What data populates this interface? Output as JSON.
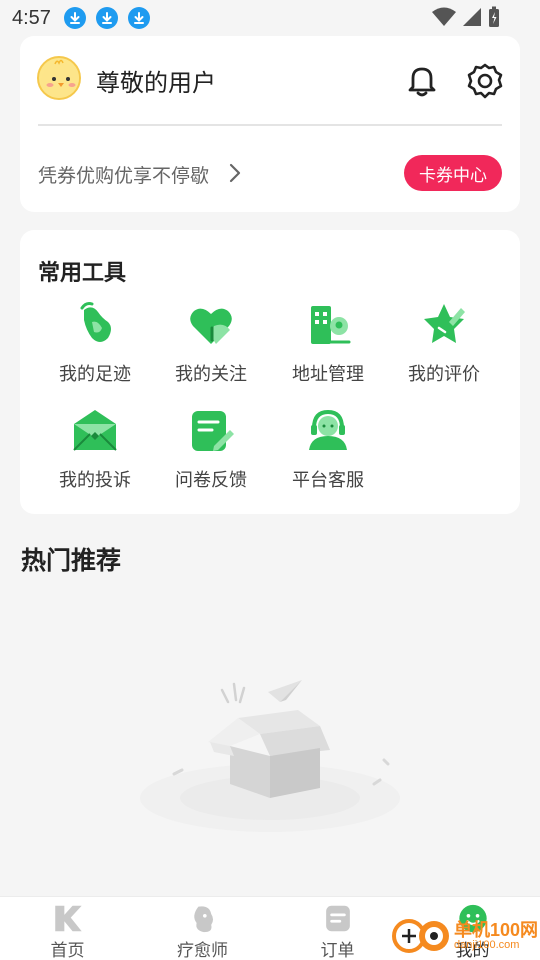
{
  "status_bar": {
    "time": "4:57",
    "download_icons": [
      "download-icon",
      "download-icon",
      "download-icon"
    ],
    "right_icons": [
      "wifi-icon",
      "signal-icon",
      "battery-icon"
    ]
  },
  "user_card": {
    "avatar_icon": "chick-avatar",
    "username": "尊敬的用户",
    "bell_icon": "bell-icon",
    "settings_icon": "gear-icon",
    "voucher_text": "凭券优购优享不停歇",
    "coupon_center_label": "卡券中心"
  },
  "tools": {
    "title": "常用工具",
    "items": [
      {
        "label": "我的足迹",
        "icon": "footprint-icon"
      },
      {
        "label": "我的关注",
        "icon": "heart-icon"
      },
      {
        "label": "地址管理",
        "icon": "location-building-icon"
      },
      {
        "label": "我的评价",
        "icon": "star-pen-icon"
      },
      {
        "label": "我的投诉",
        "icon": "envelope-icon"
      },
      {
        "label": "问卷反馈",
        "icon": "form-icon"
      },
      {
        "label": "平台客服",
        "icon": "customer-service-icon"
      }
    ]
  },
  "recommend": {
    "title": "热门推荐",
    "empty_illustration": "empty-box-icon"
  },
  "tabbar": {
    "tabs": [
      {
        "label": "首页",
        "icon": "home-k-icon"
      },
      {
        "label": "疗愈师",
        "icon": "therapist-icon"
      },
      {
        "label": "订单",
        "icon": "order-icon"
      },
      {
        "label": "我的",
        "icon": "mine-face-icon"
      }
    ],
    "active_index": 3
  },
  "watermark": {
    "text": "单机100网",
    "url": "danji100.com"
  },
  "colors": {
    "accent_green": "#2fbf59",
    "coupon_red": "#f1285a",
    "background": "#f5f5f5"
  }
}
